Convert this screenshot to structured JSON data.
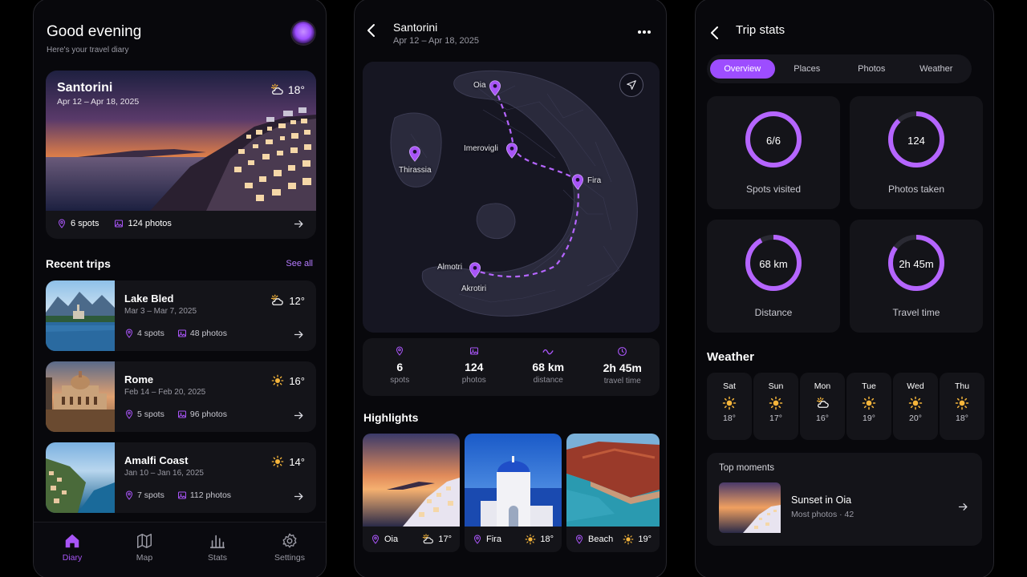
{
  "diary": {
    "greeting": "Good evening",
    "subtitle": "Here's your travel diary",
    "featured": {
      "title": "Santorini",
      "dates": "Apr 12 – Apr 18, 2025",
      "temp": "18°",
      "weather_icon": "partly-cloudy-icon",
      "spots": "6 spots",
      "photos": "124 photos"
    },
    "recent_title": "Recent trips",
    "see_all": "See all",
    "trips": [
      {
        "name": "Lake Bled",
        "dates": "Mar 3 – Mar 7, 2025",
        "temp": "12°",
        "weather_icon": "partly-cloudy-icon",
        "spots": "4 spots",
        "photos": "48 photos"
      },
      {
        "name": "Rome",
        "dates": "Feb 14 – Feb 20, 2025",
        "temp": "16°",
        "weather_icon": "sun-icon",
        "spots": "5 spots",
        "photos": "96 photos"
      },
      {
        "name": "Amalfi Coast",
        "dates": "Jan 10 – Jan 16, 2025",
        "temp": "14°",
        "weather_icon": "sun-icon",
        "spots": "7 spots",
        "photos": "112 photos"
      }
    ],
    "nav": [
      {
        "label": "Diary",
        "icon": "home-icon",
        "active": true
      },
      {
        "label": "Map",
        "icon": "map-icon",
        "active": false
      },
      {
        "label": "Stats",
        "icon": "bar-chart-icon",
        "active": false
      },
      {
        "label": "Settings",
        "icon": "gear-icon",
        "active": false
      }
    ]
  },
  "trip": {
    "title": "Santorini",
    "dates": "Apr 12 – Apr 18, 2025",
    "map_pins": {
      "oia": "Oia",
      "imerovigli": "Imerovigli",
      "fira": "Fira",
      "thirassia": "Thirassia",
      "akrotiri": "Akrotiri",
      "akrotiri_upper": "Almotri"
    },
    "stats": [
      {
        "value": "6",
        "label": "spots",
        "icon": "pin-icon"
      },
      {
        "value": "124",
        "label": "photos",
        "icon": "image-icon"
      },
      {
        "value": "68 km",
        "label": "distance",
        "icon": "route-icon"
      },
      {
        "value": "2h 45m",
        "label": "travel time",
        "icon": "clock-icon"
      }
    ],
    "highlights_title": "Highlights",
    "highlights": [
      {
        "place": "Oia",
        "temp": "17°",
        "weather_icon": "partly-cloudy-icon"
      },
      {
        "place": "Fira",
        "temp": "18°",
        "weather_icon": "sun-icon"
      },
      {
        "place": "Beach",
        "temp": "19°",
        "weather_icon": "sun-icon"
      }
    ]
  },
  "stats_page": {
    "title": "Trip stats",
    "tabs": [
      "Overview",
      "Places",
      "Photos",
      "Weather"
    ],
    "active_tab": "Overview",
    "rings": [
      {
        "value": "6/6",
        "label": "Spots visited",
        "fraction": 1.0
      },
      {
        "value": "124",
        "label": "Photos taken",
        "fraction": 0.88
      },
      {
        "value": "68 km",
        "label": "Distance",
        "fraction": 0.92
      },
      {
        "value": "2h 45m",
        "label": "Travel time",
        "fraction": 0.85
      }
    ],
    "weather_title": "Weather",
    "weather": [
      {
        "day": "Sat",
        "temp": "18°",
        "icon": "sun-icon"
      },
      {
        "day": "Sun",
        "temp": "17°",
        "icon": "sun-icon"
      },
      {
        "day": "Mon",
        "temp": "16°",
        "icon": "partly-cloudy-icon"
      },
      {
        "day": "Tue",
        "temp": "19°",
        "icon": "sun-icon"
      },
      {
        "day": "Wed",
        "temp": "20°",
        "icon": "sun-icon"
      },
      {
        "day": "Thu",
        "temp": "18°",
        "icon": "sun-icon"
      }
    ],
    "moments_title": "Top moments",
    "moment": {
      "title": "Sunset in Oia",
      "meta": "Most photos · 42"
    }
  },
  "colors": {
    "accent": "#a855f7",
    "sun": "#f5b53b",
    "background": "#08080c",
    "card": "#141419"
  }
}
